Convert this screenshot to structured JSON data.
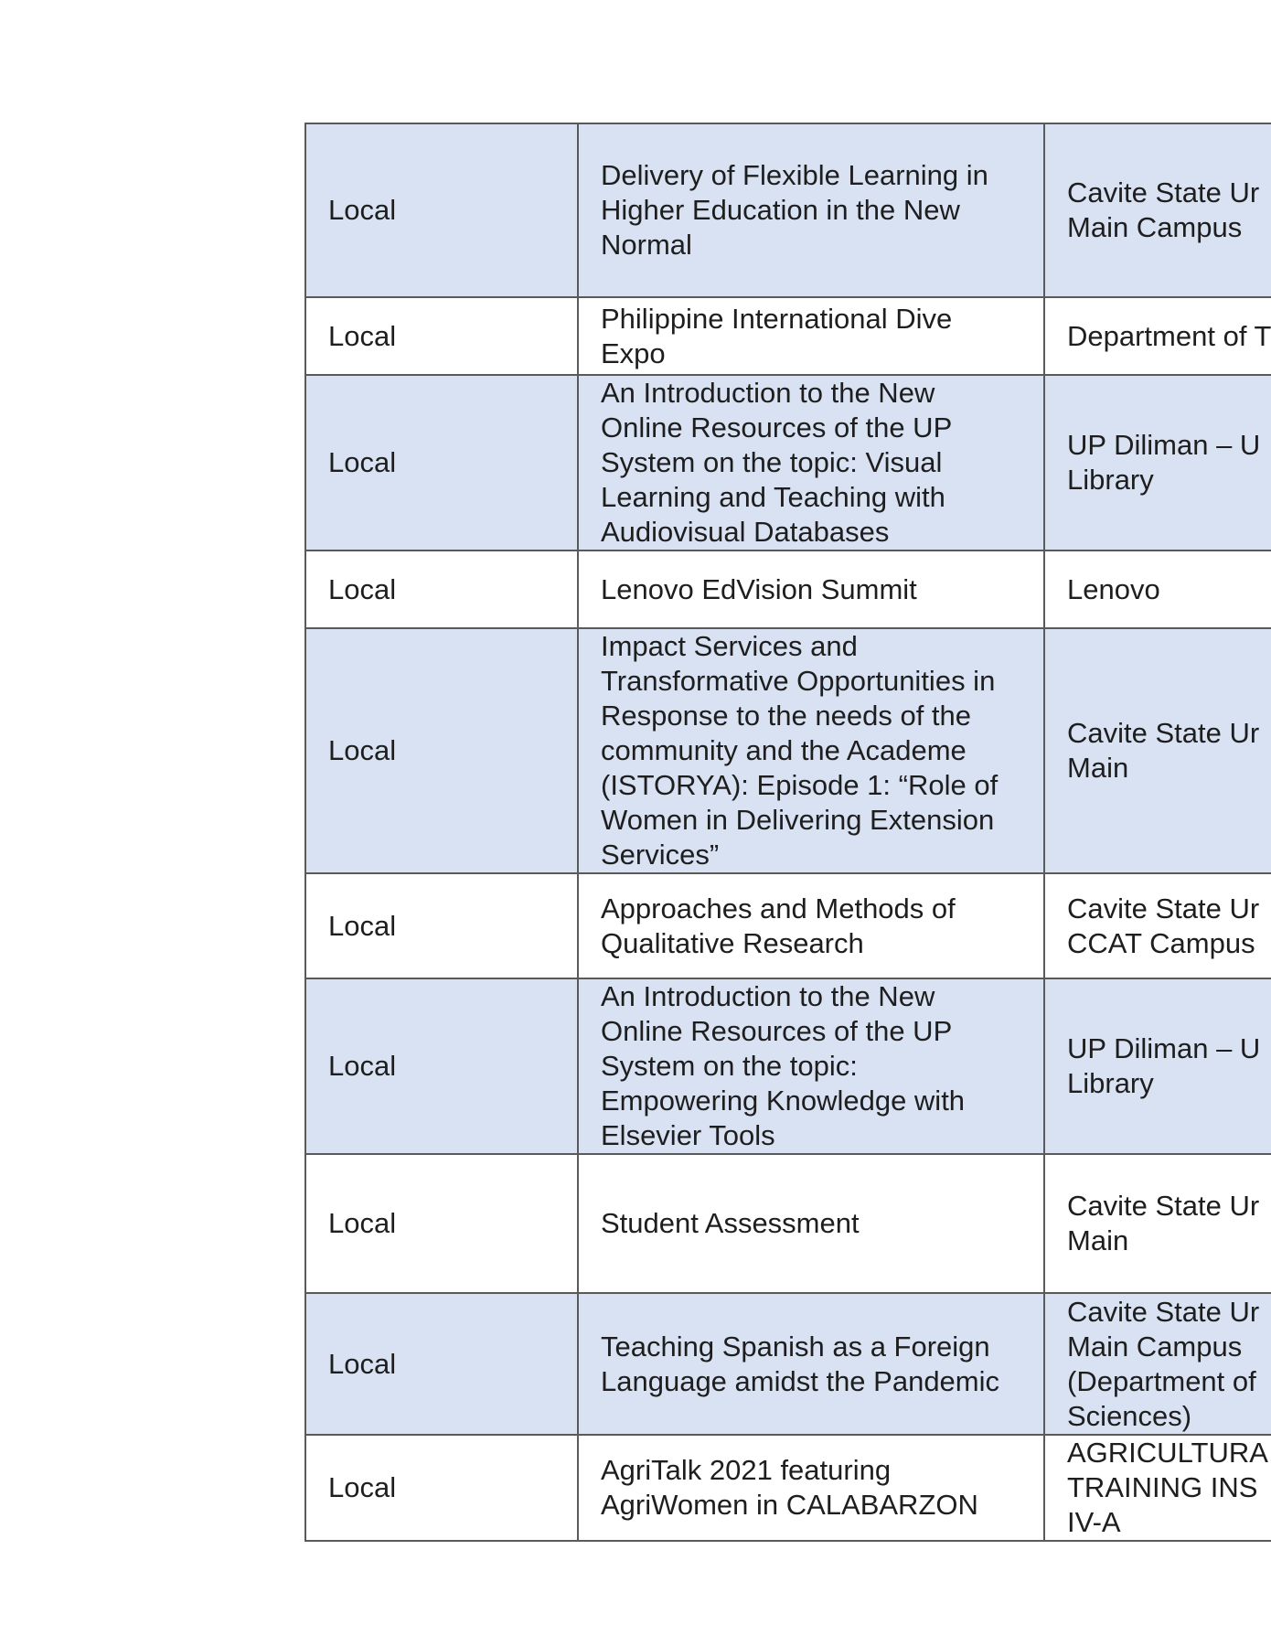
{
  "rows": [
    {
      "level": "Local",
      "title": [
        "Delivery of Flexible Learning in",
        "Higher Education in the New",
        "Normal"
      ],
      "organizer": [
        "Cavite State Ur",
        "Main Campus"
      ]
    },
    {
      "level": "Local",
      "title": [
        "Philippine International Dive",
        "Expo"
      ],
      "organizer": [
        "Department of T"
      ]
    },
    {
      "level": "Local",
      "title": [
        "An Introduction to the New",
        "Online Resources of the UP",
        "System on the topic: Visual",
        "Learning and Teaching with",
        "Audiovisual Databases"
      ],
      "organizer": [
        "UP Diliman – U",
        "Library"
      ]
    },
    {
      "level": "Local",
      "title": [
        "Lenovo EdVision Summit"
      ],
      "organizer": [
        "Lenovo"
      ]
    },
    {
      "level": "Local",
      "title": [
        "Impact Services and",
        "Transformative Opportunities in",
        "Response to the needs of the",
        "community and the Academe",
        "(ISTORYA): Episode 1: “Role of",
        "Women in Delivering Extension",
        "Services”"
      ],
      "organizer": [
        "Cavite State Ur",
        "Main"
      ]
    },
    {
      "level": "Local",
      "title": [
        "Approaches and Methods of",
        "Qualitative Research"
      ],
      "organizer": [
        "Cavite State Ur",
        "CCAT Campus"
      ]
    },
    {
      "level": "Local",
      "title": [
        "An Introduction to the New",
        "Online Resources of the UP",
        "System on the topic:",
        "Empowering Knowledge with",
        "Elsevier Tools"
      ],
      "organizer": [
        "UP Diliman – U",
        "Library"
      ]
    },
    {
      "level": "Local",
      "title": [
        "Student Assessment"
      ],
      "organizer": [
        "Cavite State Ur",
        "Main"
      ]
    },
    {
      "level": "Local",
      "title": [
        "Teaching Spanish as a Foreign",
        "Language amidst the Pandemic"
      ],
      "organizer": [
        "Cavite State Ur",
        "Main Campus",
        "(Department of",
        "Sciences)"
      ]
    },
    {
      "level": "Local",
      "title": [
        "AgriTalk 2021 featuring",
        "AgriWomen in CALABARZON"
      ],
      "organizer": [
        "AGRICULTURA",
        "TRAINING INS",
        "IV-A"
      ]
    }
  ]
}
